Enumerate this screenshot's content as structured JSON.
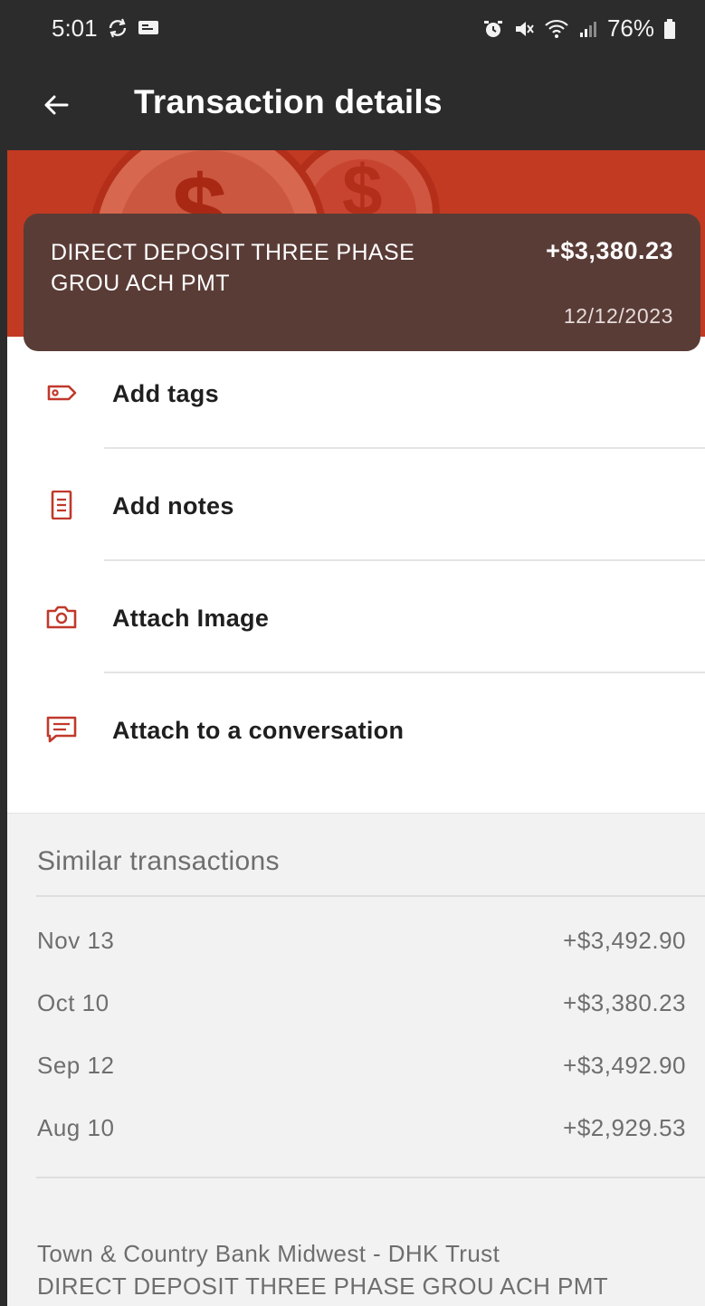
{
  "status_bar": {
    "time": "5:01",
    "left_icons": [
      "sync-icon",
      "message-icon"
    ],
    "right_icons": [
      "alarm-icon",
      "mute-icon",
      "wifi-icon",
      "signal-icon"
    ],
    "battery": "76%"
  },
  "app_bar": {
    "title": "Transaction details",
    "back_icon": "arrow-back-icon"
  },
  "transaction": {
    "description": "DIRECT DEPOSIT THREE PHASE GROU ACH PMT",
    "amount": "+$3,380.23",
    "date": "12/12/2023"
  },
  "actions": [
    {
      "label": "Add tags",
      "icon": "tag-icon"
    },
    {
      "label": "Add notes",
      "icon": "notes-icon"
    },
    {
      "label": "Attach Image",
      "icon": "camera-icon"
    },
    {
      "label": "Attach to a conversation",
      "icon": "chat-icon"
    }
  ],
  "similar": {
    "heading": "Similar transactions",
    "rows": [
      {
        "date": "Nov 13",
        "amount": "+$3,492.90"
      },
      {
        "date": "Oct 10",
        "amount": "+$3,380.23"
      },
      {
        "date": "Sep 12",
        "amount": "+$3,492.90"
      },
      {
        "date": "Aug 10",
        "amount": "+$2,929.53"
      }
    ],
    "footer_line1": "Town & Country Bank Midwest - DHK Trust",
    "footer_line2": "DIRECT DEPOSIT THREE PHASE GROU ACH PMT"
  },
  "colors": {
    "bar": "#2c2c2c",
    "banner": "#c23a22",
    "card": "#5a3c37",
    "icon_accent": "#c0392b"
  }
}
